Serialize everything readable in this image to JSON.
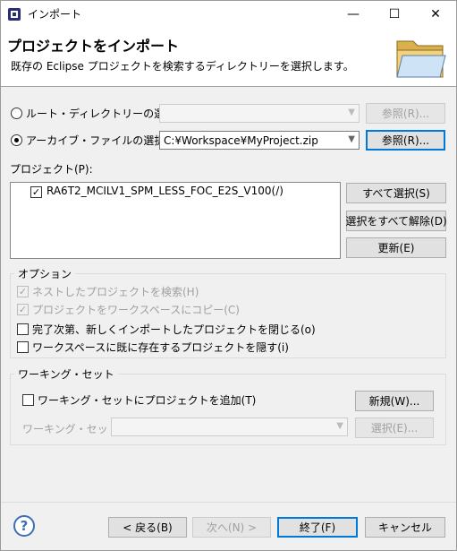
{
  "window": {
    "title": "インポート",
    "controls": {
      "minimize": "—",
      "maximize": "☐",
      "close": "✕"
    }
  },
  "header": {
    "title": "プロジェクトをインポート",
    "description": "既存の Eclipse プロジェクトを検索するディレクトリーを選択します。"
  },
  "source": {
    "root_dir_label": "ルート・ディレクトリーの選択(T):",
    "root_dir_value": "",
    "root_dir_browse": "参照(R)...",
    "archive_label": "アーカイブ・ファイルの選択(A):",
    "archive_value": "C:¥Workspace¥MyProject.zip",
    "archive_browse": "参照(R)...",
    "selected": "archive"
  },
  "projects": {
    "label": "プロジェクト(P):",
    "items": [
      {
        "name": "RA6T2_MCILV1_SPM_LESS_FOC_E2S_V100(/)",
        "checked": true
      }
    ],
    "select_all": "すべて選択(S)",
    "deselect_all": "選択をすべて解除(D)",
    "refresh": "更新(E)"
  },
  "options": {
    "label": "オプション",
    "items": [
      {
        "label": "ネストしたプロジェクトを検索(H)",
        "checked": true,
        "enabled": false
      },
      {
        "label": "プロジェクトをワークスペースにコピー(C)",
        "checked": true,
        "enabled": false
      },
      {
        "label": "完了次第、新しくインポートしたプロジェクトを閉じる(o)",
        "checked": false,
        "enabled": true
      },
      {
        "label": "ワークスペースに既に存在するプロジェクトを隠す(i)",
        "checked": false,
        "enabled": true
      }
    ]
  },
  "working_sets": {
    "label": "ワーキング・セット",
    "add_label": "ワーキング・セットにプロジェクトを追加(T)",
    "add_checked": false,
    "new_button": "新規(W)...",
    "sets_label": "ワーキング・セット(O):",
    "sets_value": "",
    "select_button": "選択(E)..."
  },
  "footer": {
    "help": "?",
    "back": "< 戻る(B)",
    "next": "次へ(N) >",
    "finish": "終了(F)",
    "cancel": "キャンセル"
  },
  "colors": {
    "accent": "#0078d7",
    "folder": "#e8c46a"
  }
}
